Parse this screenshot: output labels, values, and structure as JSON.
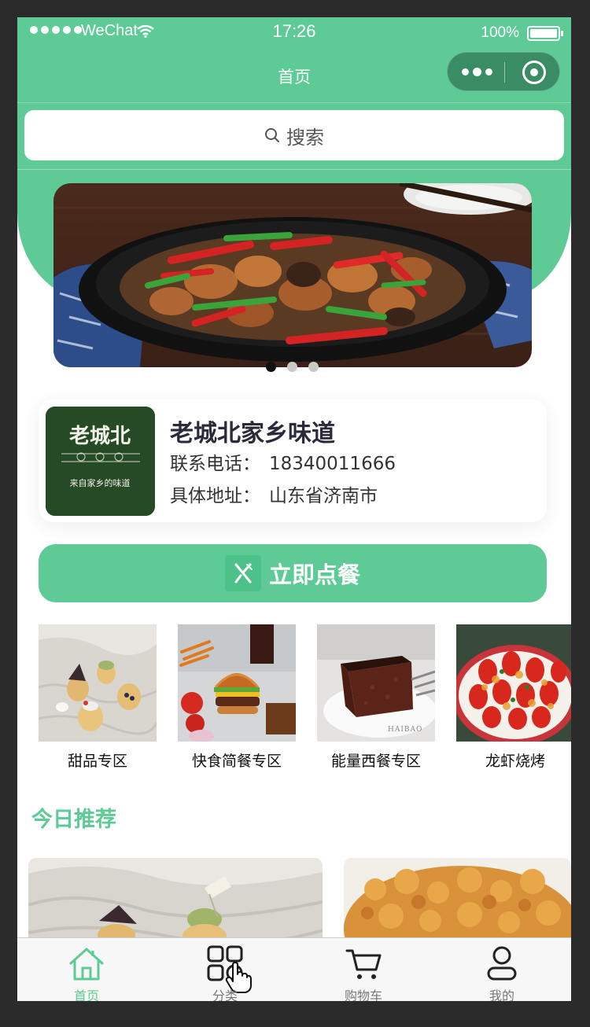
{
  "status_bar": {
    "carrier": "WeChat",
    "time": "17:26",
    "battery": "100%"
  },
  "nav": {
    "title": "首页"
  },
  "search": {
    "label": "搜索"
  },
  "banner": {
    "slide_count": 3,
    "active_slide": 1
  },
  "store": {
    "name": "老城北家乡味道",
    "phone_label": "联系电话：",
    "phone": "18340011666",
    "address_label": "具体地址：",
    "address": "山东省济南市",
    "logo_text": "老城北",
    "logo_slogan": "来自家乡的味道"
  },
  "order": {
    "label": "立即点餐"
  },
  "categories": [
    {
      "label": "甜品专区"
    },
    {
      "label": "快食简餐专区"
    },
    {
      "label": "能量西餐专区"
    },
    {
      "label": "龙虾烧烤"
    }
  ],
  "recommend": {
    "title": "今日推荐"
  },
  "tabs": [
    {
      "label": "首页",
      "icon": "home-icon",
      "active": true
    },
    {
      "label": "分类",
      "icon": "category-icon",
      "active": false
    },
    {
      "label": "购物车",
      "icon": "cart-icon",
      "active": false
    },
    {
      "label": "我的",
      "icon": "user-icon",
      "active": false
    }
  ],
  "colors": {
    "accent": "#5ecb97",
    "accent_dark": "#3a8c65",
    "text_dark": "#2a2a3a"
  }
}
